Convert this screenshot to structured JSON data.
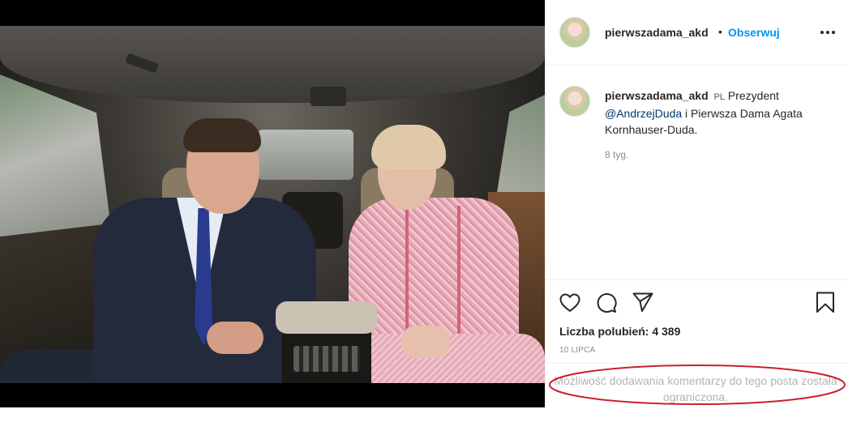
{
  "post": {
    "username": "pierwszadama_akd",
    "follow_label": "Obserwuj",
    "separator": "•",
    "caption": {
      "username": "pierwszadama_akd",
      "lang_tag": "PL",
      "text_before": "Prezydent",
      "mention": "@AndrzejDuda",
      "text_after": "i Pierwsza Dama Agata Kornhauser-Duda."
    },
    "time_ago": "8 tyg.",
    "likes": "Liczba polubień: 4 389",
    "date": "10 LIPCA",
    "comments_restricted": "Możliwość dodawania komentarzy do tego posta została ograniczona."
  },
  "icons": {
    "more": "more-horizontal-icon",
    "like": "heart-icon",
    "comment": "comment-bubble-icon",
    "share": "paper-plane-icon",
    "save": "bookmark-icon"
  },
  "colors": {
    "link": "#0095f6",
    "mention": "#00376b",
    "highlight_oval": "#cc1f2e",
    "muted": "#8e8e8e"
  }
}
